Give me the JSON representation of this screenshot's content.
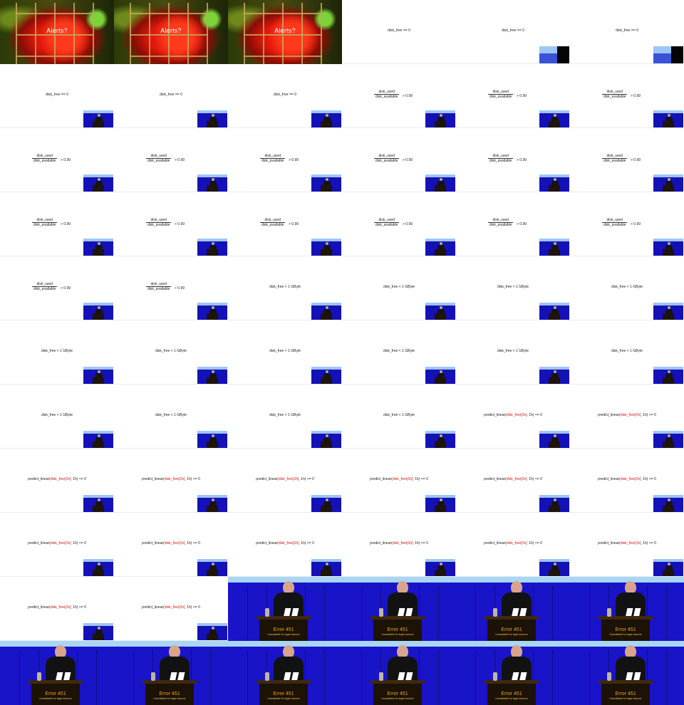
{
  "sheet": {
    "cells": [
      {
        "type": "photo",
        "caption": "Alerts?"
      },
      {
        "type": "photo",
        "caption": "Alerts?"
      },
      {
        "type": "photo",
        "caption": "Alerts?"
      },
      {
        "type": "text",
        "text": "disk_free == 0",
        "pip": "none"
      },
      {
        "type": "text",
        "text": "disk_free == 0",
        "pip": "empty"
      },
      {
        "type": "text",
        "text": "disk_free == 0",
        "pip": "empty"
      },
      {
        "type": "text",
        "text": "disk_free == 0",
        "pip": "speaker"
      },
      {
        "type": "text",
        "text": "disk_free == 0",
        "pip": "speaker"
      },
      {
        "type": "text",
        "text": "disk_free == 0",
        "pip": "speaker"
      },
      {
        "type": "fraction",
        "numerator": "disk_used",
        "denominator": "disk_available",
        "rhs": "> 0.99",
        "pip": "speaker"
      },
      {
        "type": "fraction",
        "numerator": "disk_used",
        "denominator": "disk_available",
        "rhs": "> 0.99",
        "pip": "speaker"
      },
      {
        "type": "fraction",
        "numerator": "disk_used",
        "denominator": "disk_available",
        "rhs": "> 0.99",
        "pip": "speaker"
      },
      {
        "type": "fraction",
        "numerator": "disk_used",
        "denominator": "disk_available",
        "rhs": "> 0.99",
        "pip": "speaker"
      },
      {
        "type": "fraction",
        "numerator": "disk_used",
        "denominator": "disk_available",
        "rhs": "> 0.99",
        "pip": "speaker"
      },
      {
        "type": "fraction",
        "numerator": "disk_used",
        "denominator": "disk_available",
        "rhs": "> 0.99",
        "pip": "speaker"
      },
      {
        "type": "fraction",
        "numerator": "disk_used",
        "denominator": "disk_available",
        "rhs": "> 0.99",
        "pip": "speaker"
      },
      {
        "type": "fraction",
        "numerator": "disk_used",
        "denominator": "disk_available",
        "rhs": "> 0.99",
        "pip": "speaker"
      },
      {
        "type": "fraction",
        "numerator": "disk_used",
        "denominator": "disk_available",
        "rhs": "> 0.99",
        "pip": "speaker"
      },
      {
        "type": "fraction",
        "numerator": "disk_used",
        "denominator": "disk_available",
        "rhs": "> 0.99",
        "pip": "speaker"
      },
      {
        "type": "fraction",
        "numerator": "disk_used",
        "denominator": "disk_available",
        "rhs": "> 0.99",
        "pip": "speaker"
      },
      {
        "type": "fraction",
        "numerator": "disk_used",
        "denominator": "disk_available",
        "rhs": "> 0.99",
        "pip": "speaker"
      },
      {
        "type": "fraction",
        "numerator": "disk_used",
        "denominator": "disk_available",
        "rhs": "> 0.99",
        "pip": "speaker"
      },
      {
        "type": "fraction",
        "numerator": "disk_used",
        "denominator": "disk_available",
        "rhs": "> 0.99",
        "pip": "speaker"
      },
      {
        "type": "fraction",
        "numerator": "disk_used",
        "denominator": "disk_available",
        "rhs": "> 0.99",
        "pip": "speaker"
      },
      {
        "type": "fraction",
        "numerator": "disk_used",
        "denominator": "disk_available",
        "rhs": "> 0.99",
        "pip": "speaker"
      },
      {
        "type": "fraction",
        "numerator": "disk_used",
        "denominator": "disk_available",
        "rhs": "> 0.99",
        "pip": "speaker"
      },
      {
        "type": "text",
        "text": "disk_free < 1 GByte",
        "pip": "speaker"
      },
      {
        "type": "text",
        "text": "disk_free < 1 GByte",
        "pip": "speaker"
      },
      {
        "type": "text",
        "text": "disk_free < 1 GByte",
        "pip": "speaker"
      },
      {
        "type": "text",
        "text": "disk_free < 1 GByte",
        "pip": "speaker"
      },
      {
        "type": "text",
        "text": "disk_free < 1 GByte",
        "pip": "speaker"
      },
      {
        "type": "text",
        "text": "disk_free < 1 GByte",
        "pip": "speaker"
      },
      {
        "type": "text",
        "text": "disk_free < 1 GByte",
        "pip": "speaker"
      },
      {
        "type": "text",
        "text": "disk_free < 1 GByte",
        "pip": "speaker"
      },
      {
        "type": "text",
        "text": "disk_free < 1 GByte",
        "pip": "speaker"
      },
      {
        "type": "text",
        "text": "disk_free < 1 GByte",
        "pip": "speaker"
      },
      {
        "type": "text",
        "text": "disk_free < 1 GByte",
        "pip": "speaker"
      },
      {
        "type": "text",
        "text": "disk_free < 1 GByte",
        "pip": "speaker"
      },
      {
        "type": "text",
        "text": "disk_free < 1 GByte",
        "pip": "speaker"
      },
      {
        "type": "text",
        "text": "disk_free < 1 GByte",
        "pip": "speaker"
      },
      {
        "type": "predict",
        "pre": "predict_linear(",
        "red": "disk_free[1h]",
        "post": ", 1h) <= 0",
        "pip": "speaker"
      },
      {
        "type": "predict",
        "pre": "predict_linear(",
        "red": "disk_free[1h]",
        "post": ", 1h) <= 0",
        "pip": "speaker"
      },
      {
        "type": "predict",
        "pre": "predict_linear(",
        "red": "disk_free[1h]",
        "post": ", 1h) <= 0",
        "pip": "speaker"
      },
      {
        "type": "predict",
        "pre": "predict_linear(",
        "red": "disk_free[1h]",
        "post": ", 1h) <= 0",
        "pip": "speaker"
      },
      {
        "type": "predict",
        "pre": "predict_linear(",
        "red": "disk_free[1h]",
        "post": ", 1h) <= 0",
        "pip": "speaker"
      },
      {
        "type": "predict",
        "pre": "predict_linear(",
        "red": "disk_free[1h]",
        "post": ", 1h) <= 0",
        "pip": "speaker"
      },
      {
        "type": "predict",
        "pre": "predict_linear(",
        "red": "disk_free[1h]",
        "post": ", 1h) <= 0",
        "pip": "speaker"
      },
      {
        "type": "predict",
        "pre": "predict_linear(",
        "red": "disk_free[1h]",
        "post": ", 1h) <= 0",
        "pip": "speaker"
      },
      {
        "type": "predict",
        "pre": "predict_linear(",
        "red": "disk_free[1h]",
        "post": ", 1h) <= 0",
        "pip": "speaker"
      },
      {
        "type": "predict",
        "pre": "predict_linear(",
        "red": "disk_free[1h]",
        "post": ", 1h) <= 0",
        "pip": "speaker"
      },
      {
        "type": "predict",
        "pre": "predict_linear(",
        "red": "disk_free[1h]",
        "post": ", 1h) <= 0",
        "pip": "speaker"
      },
      {
        "type": "predict",
        "pre": "predict_linear(",
        "red": "disk_free[1h]",
        "post": ", 1h) <= 0",
        "pip": "speaker"
      },
      {
        "type": "predict",
        "pre": "predict_linear(",
        "red": "disk_free[1h]",
        "post": ", 1h) <= 0",
        "pip": "speaker"
      },
      {
        "type": "predict",
        "pre": "predict_linear(",
        "red": "disk_free[1h]",
        "post": ", 1h) <= 0",
        "pip": "speaker"
      },
      {
        "type": "predict",
        "pre": "predict_linear(",
        "red": "disk_free[1h]",
        "post": ", 1h) <= 0",
        "pip": "speaker"
      },
      {
        "type": "predict",
        "pre": "predict_linear(",
        "red": "disk_free[1h]",
        "post": ", 1h) <= 0",
        "pip": "speaker"
      },
      {
        "type": "stage",
        "brand": "Error 451",
        "tagline": "Unavailable for legal reasons"
      },
      {
        "type": "stage",
        "brand": "Error 451",
        "tagline": "Unavailable for legal reasons"
      },
      {
        "type": "stage",
        "brand": "Error 451",
        "tagline": "Unavailable for legal reasons"
      },
      {
        "type": "stage",
        "brand": "Error 451",
        "tagline": "Unavailable for legal reasons"
      },
      {
        "type": "stage",
        "brand": "Error 451",
        "tagline": "Unavailable for legal reasons"
      },
      {
        "type": "stage",
        "brand": "Error 451",
        "tagline": "Unavailable for legal reasons"
      },
      {
        "type": "stage",
        "brand": "Error 451",
        "tagline": "Unavailable for legal reasons"
      },
      {
        "type": "stage",
        "brand": "Error 451",
        "tagline": "Unavailable for legal reasons"
      },
      {
        "type": "stage",
        "brand": "Error 451",
        "tagline": "Unavailable for legal reasons"
      },
      {
        "type": "stage",
        "brand": "Error 451",
        "tagline": "Unavailable for legal reasons"
      }
    ]
  }
}
